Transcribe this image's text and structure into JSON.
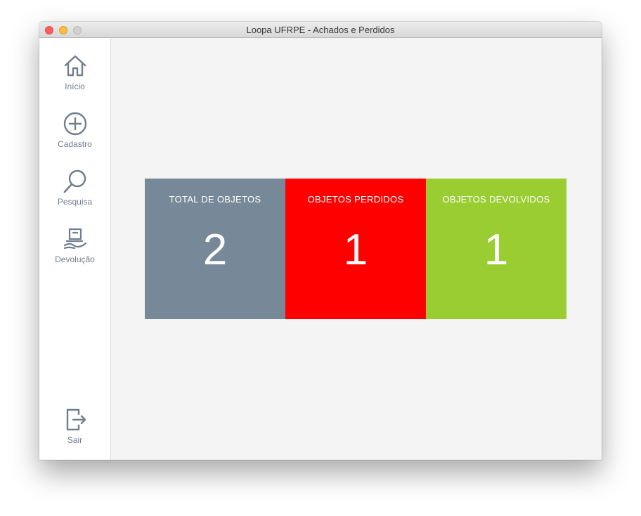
{
  "window": {
    "title": "Loopa UFRPE - Achados e Perdidos"
  },
  "sidebar": {
    "items": [
      {
        "label": "Início",
        "icon": "home-icon"
      },
      {
        "label": "Cadastro",
        "icon": "plus-circle-icon"
      },
      {
        "label": "Pesquisa",
        "icon": "search-icon"
      },
      {
        "label": "Devolução",
        "icon": "handover-icon"
      }
    ],
    "logout": {
      "label": "Sair",
      "icon": "logout-icon"
    }
  },
  "stats": [
    {
      "title": "TOTAL DE OBJETOS",
      "value": "2",
      "color": "#778899"
    },
    {
      "title": "OBJETOS PERDIDOS",
      "value": "1",
      "color": "#ff0000"
    },
    {
      "title": "OBJETOS DEVOLVIDOS",
      "value": "1",
      "color": "#9acd32"
    }
  ],
  "colors": {
    "icon": "#6f7d8f",
    "sidebar_bg": "#ffffff",
    "content_bg": "#f4f4f4"
  }
}
